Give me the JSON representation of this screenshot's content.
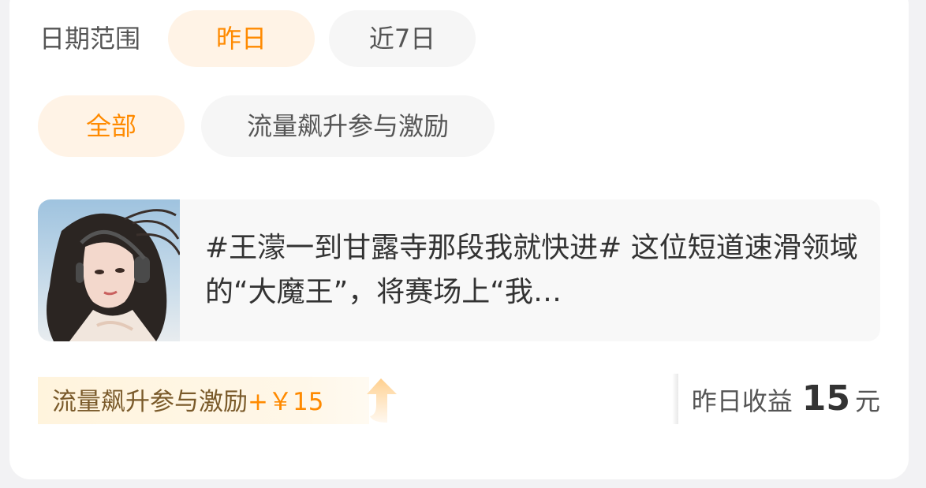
{
  "filters": {
    "date_range_label": "日期范围",
    "date_options": [
      "昨日",
      "近7日"
    ],
    "date_selected": "昨日",
    "category_options": [
      "全部",
      "流量飙升参与激励"
    ],
    "category_selected": "全部"
  },
  "content_item": {
    "text": "#王濛一到甘露寺那段我就快进# 这位短道速滑领域的“大魔王”，将赛场上“我…",
    "thumbnail": "avatar-girl-headphones"
  },
  "reward": {
    "label": "流量飙升参与激励",
    "amount": "+￥15",
    "icon": "up-arrow-icon"
  },
  "earnings": {
    "label": "昨日收益",
    "value": "15",
    "unit": "元"
  },
  "colors": {
    "accent": "#ff8a00",
    "active_pill_bg": "#fff3e6",
    "inactive_pill_bg": "#f6f6f6",
    "reward_bg": "#fff4dd"
  }
}
